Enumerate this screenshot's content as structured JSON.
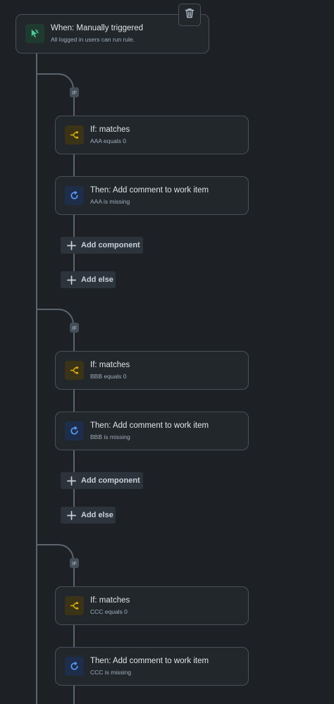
{
  "trigger": {
    "title": "When: Manually triggered",
    "subtitle": "All logged in users can run rule.",
    "icon": "cursor-click-icon",
    "delete_icon": "trash-icon"
  },
  "colors": {
    "background": "#1d2125",
    "card": "#22272b",
    "condition_accent": "#e2b203",
    "action_accent": "#579dff",
    "trigger_accent": "#4bce97"
  },
  "branches": [
    {
      "badge": "IF",
      "condition": {
        "title": "If: matches",
        "subtitle": "AAA equals 0"
      },
      "action": {
        "title": "Then: Add comment to work item",
        "subtitle": "AAA is missing"
      },
      "add_component_label": "Add component",
      "add_else_label": "Add else"
    },
    {
      "badge": "IF",
      "condition": {
        "title": "If: matches",
        "subtitle": "BBB equals 0"
      },
      "action": {
        "title": "Then: Add comment to work item",
        "subtitle": "BBB is missing"
      },
      "add_component_label": "Add component",
      "add_else_label": "Add else"
    },
    {
      "badge": "IF",
      "condition": {
        "title": "If: matches",
        "subtitle": "CCC equals 0"
      },
      "action": {
        "title": "Then: Add comment to work item",
        "subtitle": "CCC is missing"
      }
    }
  ]
}
